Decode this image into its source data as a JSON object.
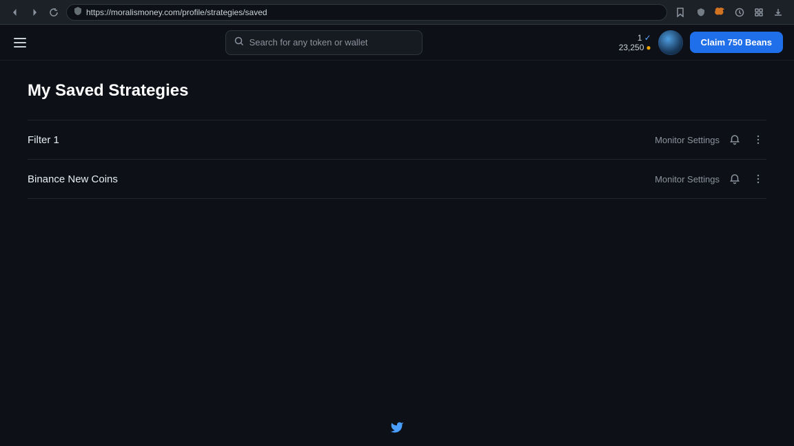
{
  "browser": {
    "url": "https://moralismoney.com/profile/strategies/saved",
    "back_icon": "←",
    "forward_icon": "→",
    "refresh_icon": "↻",
    "shield_icon": "🔒",
    "star_icon": "☆",
    "extensions": [
      "shield",
      "fox",
      "clock",
      "puzzle",
      "download"
    ]
  },
  "header": {
    "hamburger_label": "menu",
    "search_placeholder": "Search for any token or wallet",
    "beans_count": "1",
    "check_label": "✓",
    "beans_amount": "23,250",
    "coin_icon": "🪙",
    "claim_button_label": "Claim 750 Beans"
  },
  "page": {
    "title": "My Saved Strategies"
  },
  "strategies": [
    {
      "id": 1,
      "name": "Filter 1",
      "monitor_settings_label": "Monitor Settings"
    },
    {
      "id": 2,
      "name": "Binance New Coins",
      "monitor_settings_label": "Monitor Settings"
    }
  ],
  "footer": {
    "twitter_icon": "🐦"
  }
}
